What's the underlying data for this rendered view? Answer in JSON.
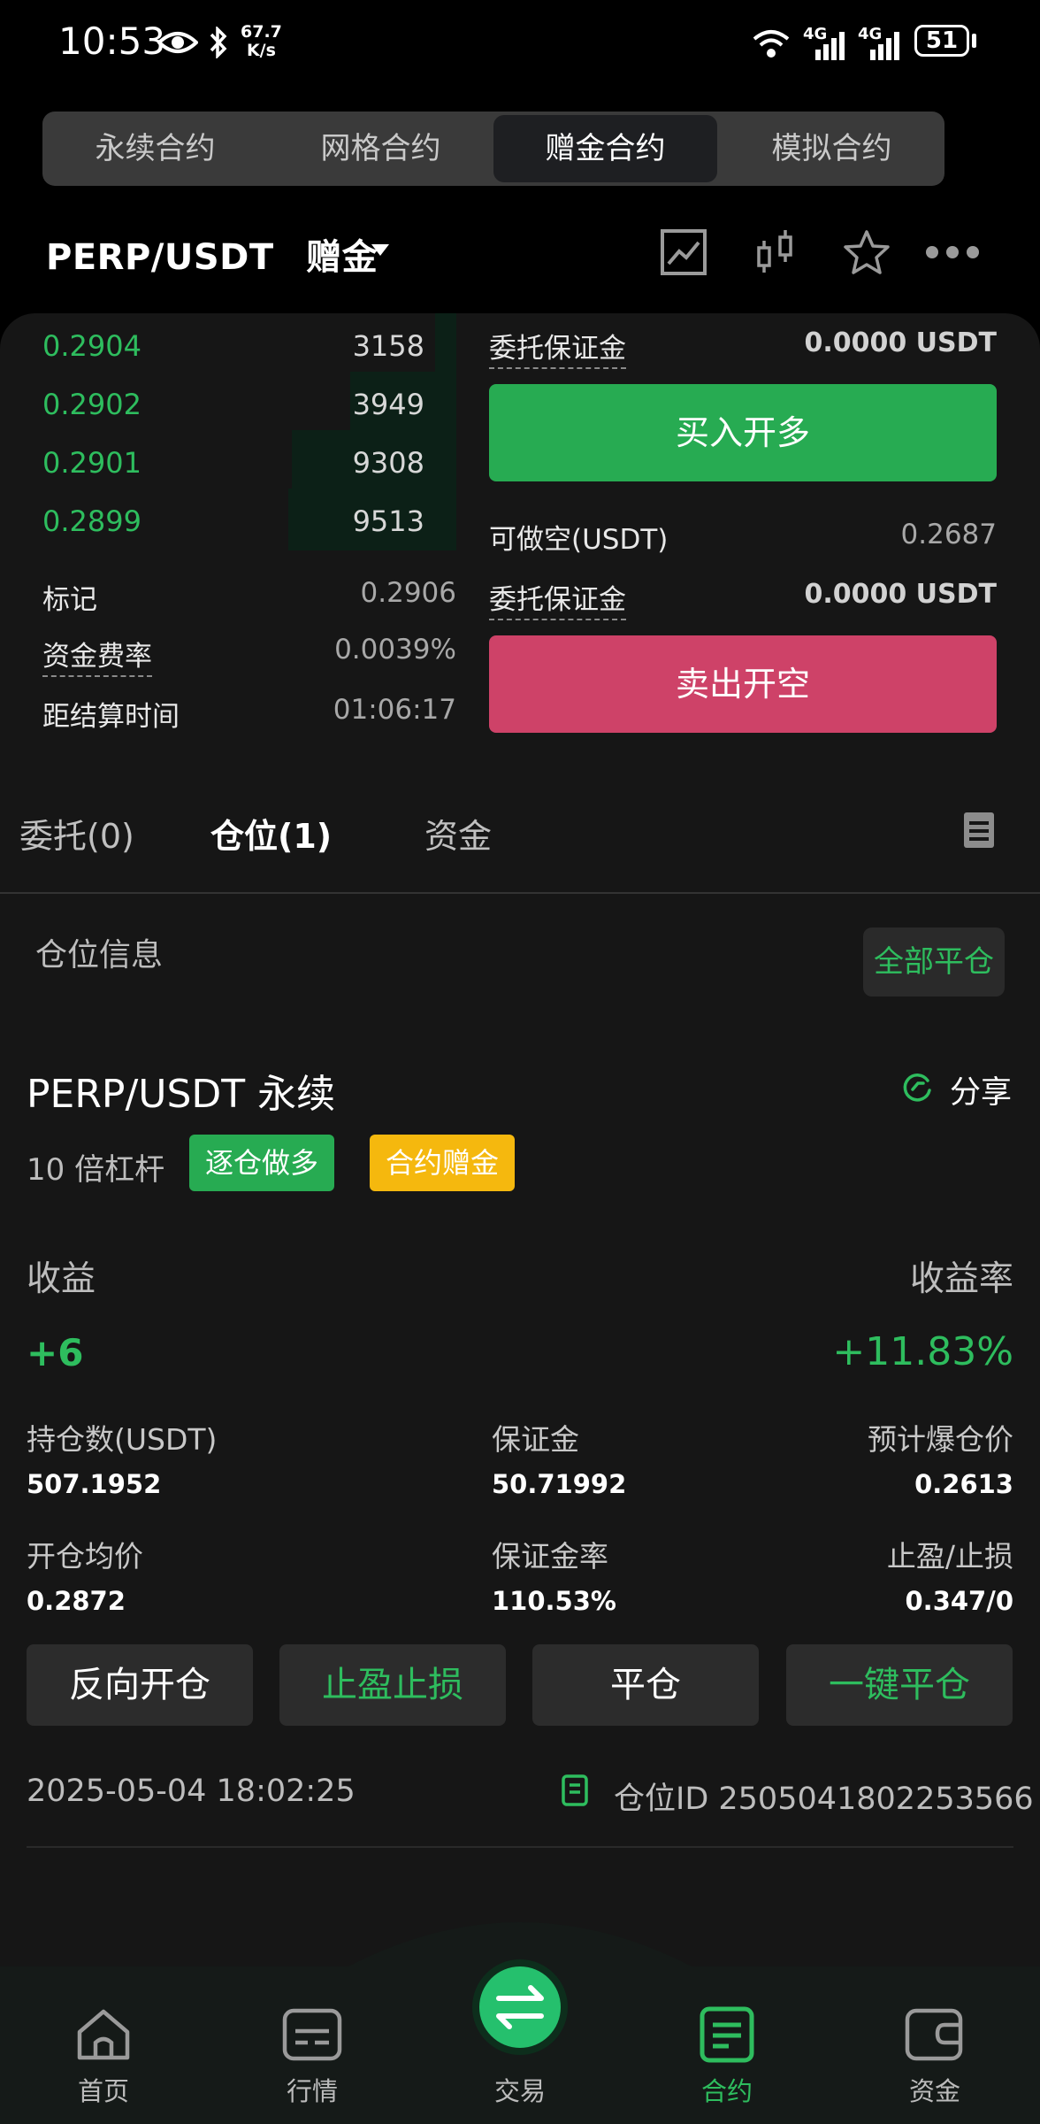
{
  "status_bar": {
    "time": "10:53",
    "speed_value": "67.7",
    "speed_unit": "K/s",
    "net1": "4G",
    "net2": "4G",
    "battery": "51"
  },
  "top_tabs": [
    {
      "label": "永续合约",
      "active": false
    },
    {
      "label": "网格合约",
      "active": false
    },
    {
      "label": "赠金合约",
      "active": true
    },
    {
      "label": "模拟合约",
      "active": false
    }
  ],
  "header": {
    "pair": "PERP/USDT",
    "tag": "赠金",
    "icons": [
      "chart-line-icon",
      "candlestick-icon",
      "star-icon",
      "more-icon"
    ]
  },
  "orderbook": {
    "bids": [
      {
        "price": "0.2904",
        "qty": "3158"
      },
      {
        "price": "0.2902",
        "qty": "3949"
      },
      {
        "price": "0.2901",
        "qty": "9308"
      },
      {
        "price": "0.2899",
        "qty": "9513"
      }
    ],
    "mark_label": "标记",
    "mark_value": "0.2906",
    "funding_label": "资金费率",
    "funding_value": "0.0039%",
    "settle_label": "距结算时间",
    "settle_value": "01:06:17"
  },
  "trade": {
    "margin_label": "委托保证金",
    "margin_value": "0.0000 USDT",
    "buy_label": "买入开多",
    "short_label": "可做空(USDT)",
    "short_value": "0.2687",
    "margin2_label": "委托保证金",
    "margin2_value": "0.0000 USDT",
    "sell_label": "卖出开空"
  },
  "order_tabs": [
    {
      "label": "委托(0)",
      "active": false
    },
    {
      "label": "仓位(1)",
      "active": true
    },
    {
      "label": "资金",
      "active": false
    }
  ],
  "position": {
    "section_title": "仓位信息",
    "close_all": "全部平仓",
    "symbol": "PERP/USDT 永续",
    "share": "分享",
    "leverage": "10 倍杠杆",
    "badge_mode": "逐仓做多",
    "badge_bonus": "合约赠金",
    "pnl_label": "收益",
    "pnl_value": "+6",
    "roe_label": "收益率",
    "roe_value": "+11.83%",
    "size_label": "持仓数(USDT)",
    "size_value": "507.1952",
    "margin_label": "保证金",
    "margin_value": "50.71992",
    "liq_label": "预计爆仓价",
    "liq_value": "0.2613",
    "entry_label": "开仓均价",
    "entry_value": "0.2872",
    "margin_ratio_label": "保证金率",
    "margin_ratio_value": "110.53%",
    "tpsl_label": "止盈/止损",
    "tpsl_value": "0.347/0",
    "actions": [
      "反向开仓",
      "止盈止损",
      "平仓",
      "一键平仓"
    ],
    "timestamp": "2025-05-04 18:02:25",
    "id_label": "仓位ID 2505041802253566"
  },
  "bottom_nav": [
    {
      "label": "首页",
      "icon": "home-icon",
      "active": false
    },
    {
      "label": "行情",
      "icon": "market-icon",
      "active": false
    },
    {
      "label": "交易",
      "icon": "swap-icon",
      "active": false
    },
    {
      "label": "合约",
      "icon": "contract-icon",
      "active": true
    },
    {
      "label": "资金",
      "icon": "wallet-icon",
      "active": false
    }
  ],
  "colors": {
    "green": "#2ebd5e",
    "buy": "#27ab52",
    "sell": "#ce4268",
    "badge_yellow": "#f5b80e",
    "bg": "#161616"
  }
}
